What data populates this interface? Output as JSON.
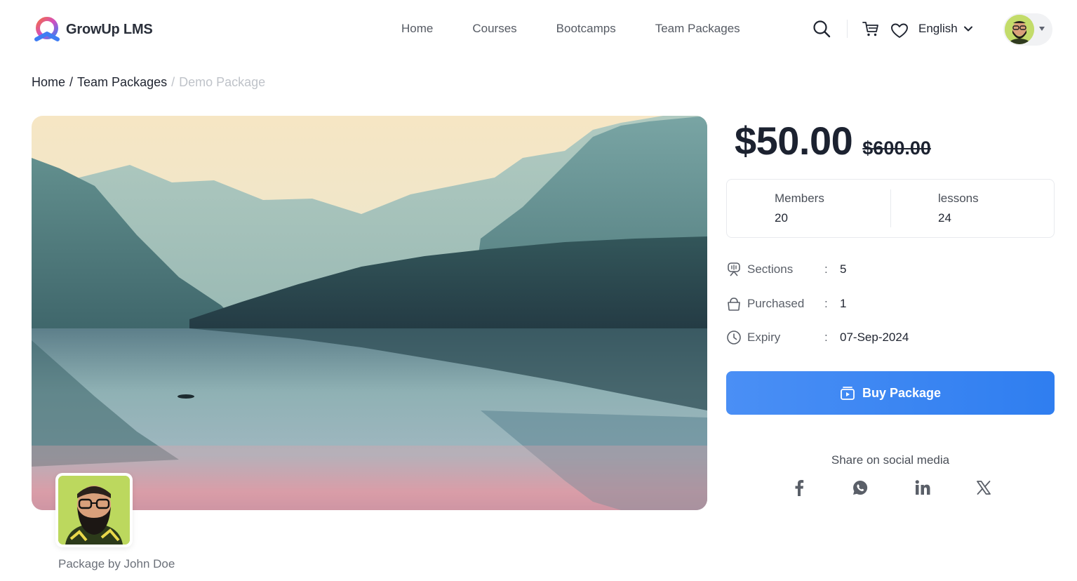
{
  "header": {
    "logo_text": "GrowUp LMS",
    "nav": [
      "Home",
      "Courses",
      "Bootcamps",
      "Team Packages"
    ],
    "language": "English"
  },
  "breadcrumb": {
    "home": "Home",
    "section": "Team Packages",
    "current": "Demo Package",
    "separator": "/"
  },
  "package": {
    "price": "$50.00",
    "old_price": "$600.00",
    "author_line": "Package by John Doe"
  },
  "stats": {
    "members_label": "Members",
    "members_value": "20",
    "lessons_label": "lessons",
    "lessons_value": "24"
  },
  "info": {
    "sections_label": "Sections",
    "sections_value": "5",
    "purchased_label": "Purchased",
    "purchased_value": "1",
    "expiry_label": "Expiry",
    "expiry_value": "07-Sep-2024",
    "colon": ":"
  },
  "actions": {
    "buy_label": "Buy Package",
    "share_title": "Share on social media"
  },
  "icons": [
    "search-icon",
    "cart-icon",
    "heart-icon",
    "chevron-down-icon",
    "sections-icon",
    "basket-icon",
    "clock-icon",
    "package-icon",
    "facebook-icon",
    "whatsapp-icon",
    "linkedin-icon",
    "x-icon"
  ],
  "colors": {
    "accent": "#3b86f2",
    "text_dark": "#1c2230",
    "muted": "#bfc3c9"
  }
}
